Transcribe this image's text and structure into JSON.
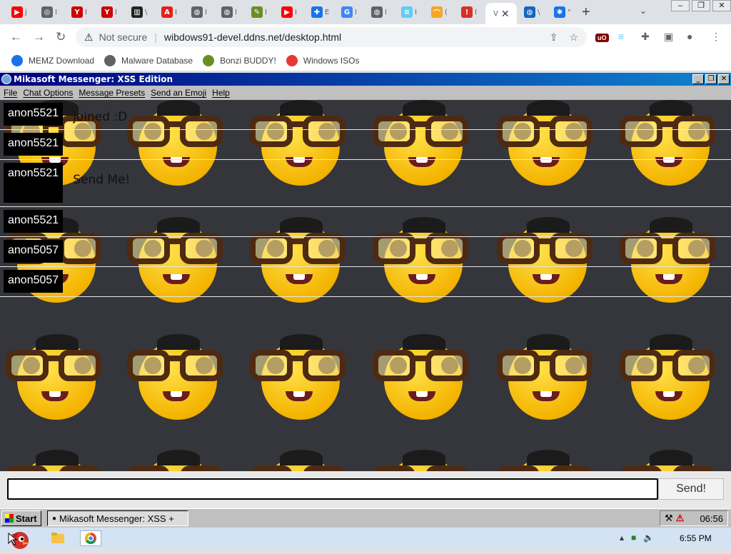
{
  "browser": {
    "tabs": [
      {
        "icon": "youtube-icon",
        "color": "#ff0000",
        "glyph": "▶",
        "char": "j"
      },
      {
        "icon": "chrome-icon",
        "color": "#5f6368",
        "glyph": "◎",
        "char": "I"
      },
      {
        "icon": "youtube-logo-icon",
        "color": "#cc0000",
        "glyph": "Y",
        "char": "I"
      },
      {
        "icon": "youtube-logo-icon",
        "color": "#cc0000",
        "glyph": "Y",
        "char": "I"
      },
      {
        "icon": "archive-icon",
        "color": "#222222",
        "glyph": "▥",
        "char": "\\"
      },
      {
        "icon": "adobe-icon",
        "color": "#e32119",
        "glyph": "A",
        "char": "I"
      },
      {
        "icon": "globe-icon",
        "color": "#5f6368",
        "glyph": "◍",
        "char": "I"
      },
      {
        "icon": "globe-icon",
        "color": "#5f6368",
        "glyph": "◍",
        "char": "I"
      },
      {
        "icon": "bonzi-icon",
        "color": "#6b8e23",
        "glyph": "✎",
        "char": "I"
      },
      {
        "icon": "youtube-icon",
        "color": "#ff0000",
        "glyph": "▶",
        "char": "I"
      },
      {
        "icon": "puzzle-icon",
        "color": "#1a73e8",
        "glyph": "✚",
        "char": "E"
      },
      {
        "icon": "google-icon",
        "color": "#4285f4",
        "glyph": "G",
        "char": "I"
      },
      {
        "icon": "globe-icon",
        "color": "#5f6368",
        "glyph": "◍",
        "char": "I"
      },
      {
        "icon": "trans-flag-icon",
        "color": "#5bcefa",
        "glyph": "≡",
        "char": "I"
      },
      {
        "icon": "rainbow-icon",
        "color": "#f5a623",
        "glyph": "⌒",
        "char": "("
      },
      {
        "icon": "dislike-icon",
        "color": "#d93025",
        "glyph": "!",
        "char": "I"
      }
    ],
    "active_tab": {
      "char": "V",
      "close": "✕"
    },
    "after_tabs": [
      {
        "icon": "globe-icon",
        "color": "#1565c0",
        "glyph": "◍",
        "char": "\\"
      },
      {
        "icon": "gear-icon",
        "color": "#1a73e8",
        "glyph": "✱",
        "char": "\""
      }
    ],
    "new_tab": "+",
    "tab_menu": "⌄",
    "window_controls": {
      "minimize": "–",
      "restore": "❐",
      "close": "✕"
    },
    "address": {
      "security_icon": "⚠",
      "security_label": "Not secure",
      "separator": "|",
      "url": "wibdows91-devel.ddns.net/desktop.html"
    },
    "bookmarks": [
      {
        "label": "MEMZ Download",
        "icon": "memz-icon",
        "color": "#1a73e8"
      },
      {
        "label": "Malware Database",
        "icon": "globe-icon",
        "color": "#5f6368"
      },
      {
        "label": "Bonzi BUDDY!",
        "icon": "bonzi-icon",
        "color": "#6b8e23"
      },
      {
        "label": "Windows ISOs",
        "icon": "windows-flag-icon",
        "color": "#e53935"
      }
    ]
  },
  "messenger": {
    "title": "Mikasoft Messenger: XSS Edition",
    "title_controls": {
      "minimize": "_",
      "maximize": "❐",
      "close": "✕"
    },
    "menu": [
      "File",
      "Chat Options",
      "Message Presets",
      "Send an Emoji",
      "Help"
    ],
    "messages": [
      {
        "user": "anon5521",
        "text": "joined :D"
      },
      {
        "user": "anon5521",
        "text": ""
      },
      {
        "user": "anon5521",
        "text": "Send Me!"
      },
      {
        "user": "anon5521",
        "text": ""
      },
      {
        "user": "anon5057",
        "text": ""
      },
      {
        "user": "anon5057",
        "text": ""
      }
    ],
    "input_value": "",
    "send_label": "Send!"
  },
  "w95_taskbar": {
    "start_label": "Start",
    "task_label": "Mikasoft Messenger: XSS +",
    "clock": "06:56"
  },
  "host_taskbar": {
    "clock": "6:55 PM"
  }
}
